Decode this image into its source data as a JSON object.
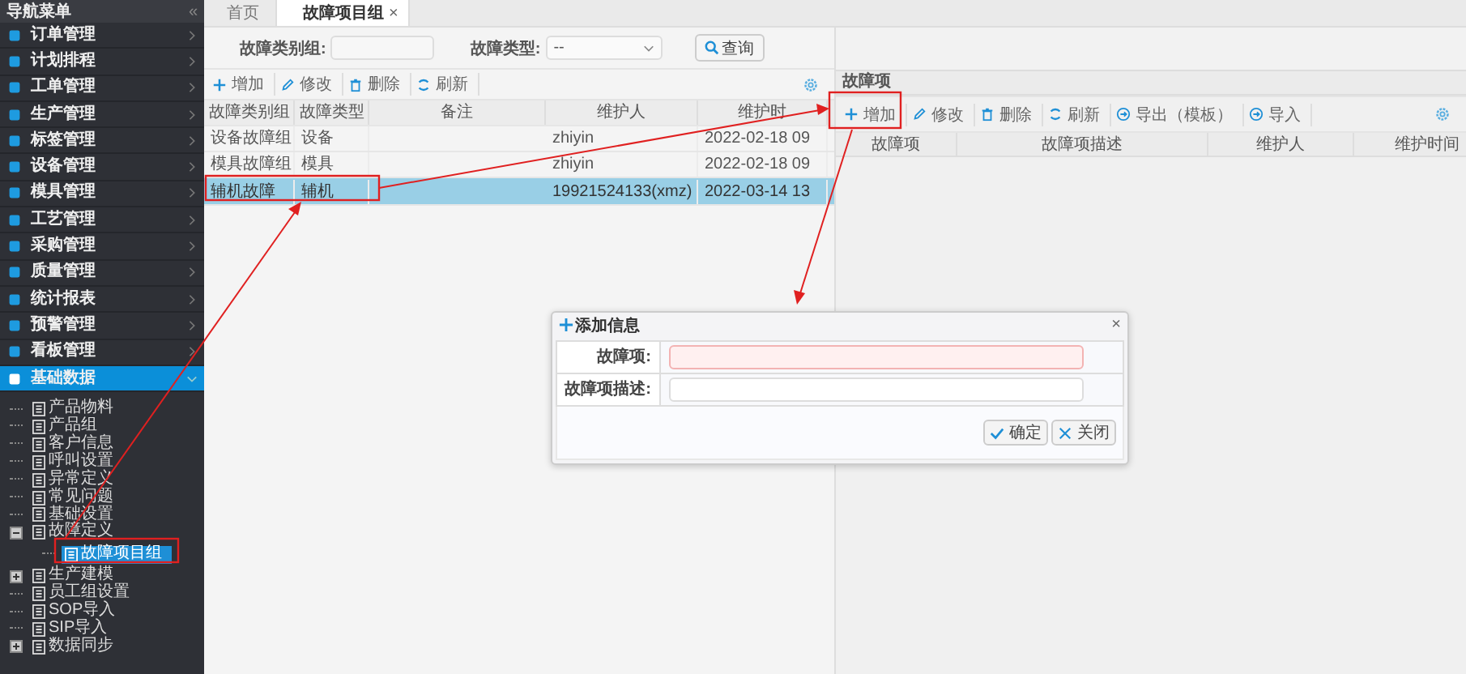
{
  "sidebar": {
    "title": "导航菜单",
    "collapse_glyph": "«",
    "menu": [
      {
        "label": "订单管理",
        "expanded": false
      },
      {
        "label": "计划排程",
        "expanded": false
      },
      {
        "label": "工单管理",
        "expanded": false
      },
      {
        "label": "生产管理",
        "expanded": false
      },
      {
        "label": "标签管理",
        "expanded": false
      },
      {
        "label": "设备管理",
        "expanded": false
      },
      {
        "label": "模具管理",
        "expanded": false
      },
      {
        "label": "工艺管理",
        "expanded": false
      },
      {
        "label": "采购管理",
        "expanded": false
      },
      {
        "label": "质量管理",
        "expanded": false
      },
      {
        "label": "统计报表",
        "expanded": false
      },
      {
        "label": "预警管理",
        "expanded": false
      },
      {
        "label": "看板管理",
        "expanded": false
      },
      {
        "label": "基础数据",
        "expanded": true
      }
    ],
    "tree": [
      {
        "label": "产品物料",
        "kind": "leaf",
        "selected": false
      },
      {
        "label": "产品组",
        "kind": "leaf",
        "selected": false
      },
      {
        "label": "客户信息",
        "kind": "leaf",
        "selected": false
      },
      {
        "label": "呼叫设置",
        "kind": "leaf",
        "selected": false
      },
      {
        "label": "异常定义",
        "kind": "leaf",
        "selected": false
      },
      {
        "label": "常见问题",
        "kind": "leaf",
        "selected": false
      },
      {
        "label": "基础设置",
        "kind": "leaf",
        "selected": false
      },
      {
        "label": "故障定义",
        "kind": "folder",
        "expanded": true,
        "selected": false,
        "children": [
          {
            "label": "故障项目组",
            "selected": true
          }
        ]
      },
      {
        "label": "生产建模",
        "kind": "folder",
        "expanded": false,
        "selected": false
      },
      {
        "label": "员工组设置",
        "kind": "leaf",
        "selected": false
      },
      {
        "label": "SOP导入",
        "kind": "leaf",
        "selected": false
      },
      {
        "label": "SIP导入",
        "kind": "leaf",
        "selected": false
      },
      {
        "label": "数据同步",
        "kind": "folder",
        "expanded": false,
        "selected": false
      }
    ]
  },
  "tabs": [
    {
      "label": "首页",
      "selected": false
    },
    {
      "label": "故障项目组",
      "selected": true,
      "close": "×"
    }
  ],
  "filters": [
    {
      "label": "故障类别组:",
      "kind": "text"
    },
    {
      "label": "故障类型:",
      "kind": "select",
      "value": "--"
    }
  ],
  "search_button": "查询",
  "left_toolbar": [
    {
      "label": "增加",
      "kind": "plus"
    },
    {
      "label": "修改",
      "kind": "pencil"
    },
    {
      "label": "删除",
      "kind": "trash"
    },
    {
      "label": "刷新",
      "kind": "refresh"
    }
  ],
  "left_table": {
    "columns": [
      "故障类别组",
      "故障类型",
      "备注",
      "维护人",
      "维护时"
    ],
    "rows": [
      {
        "cells": [
          "设备故障组",
          "设备",
          "",
          "zhiyin",
          "2022-02-18 09"
        ],
        "selected": false
      },
      {
        "cells": [
          "模具故障组",
          "模具",
          "",
          "zhiyin",
          "2022-02-18 09"
        ],
        "selected": false
      },
      {
        "cells": [
          "辅机故障",
          "辅机",
          "",
          "19921524133(xmz)",
          "2022-03-14 13"
        ],
        "selected": true
      }
    ]
  },
  "right_panel": {
    "title": "故障项",
    "toolbar": [
      {
        "label": "增加",
        "kind": "plus"
      },
      {
        "label": "修改",
        "kind": "pencil"
      },
      {
        "label": "删除",
        "kind": "trash"
      },
      {
        "label": "刷新",
        "kind": "refresh"
      },
      {
        "label": "导出（模板）",
        "kind": "export"
      },
      {
        "label": "导入",
        "kind": "export"
      }
    ],
    "columns": [
      "故障项",
      "故障项描述",
      "维护人",
      "维护时间"
    ]
  },
  "dialog": {
    "title": "添加信息",
    "close": "×",
    "fields": [
      {
        "label": "故障项:",
        "invalid": true
      },
      {
        "label": "故障项描述:",
        "invalid": false
      }
    ],
    "buttons": [
      {
        "label": "确定",
        "kind": "ok"
      },
      {
        "label": "关闭",
        "kind": "close"
      }
    ]
  }
}
